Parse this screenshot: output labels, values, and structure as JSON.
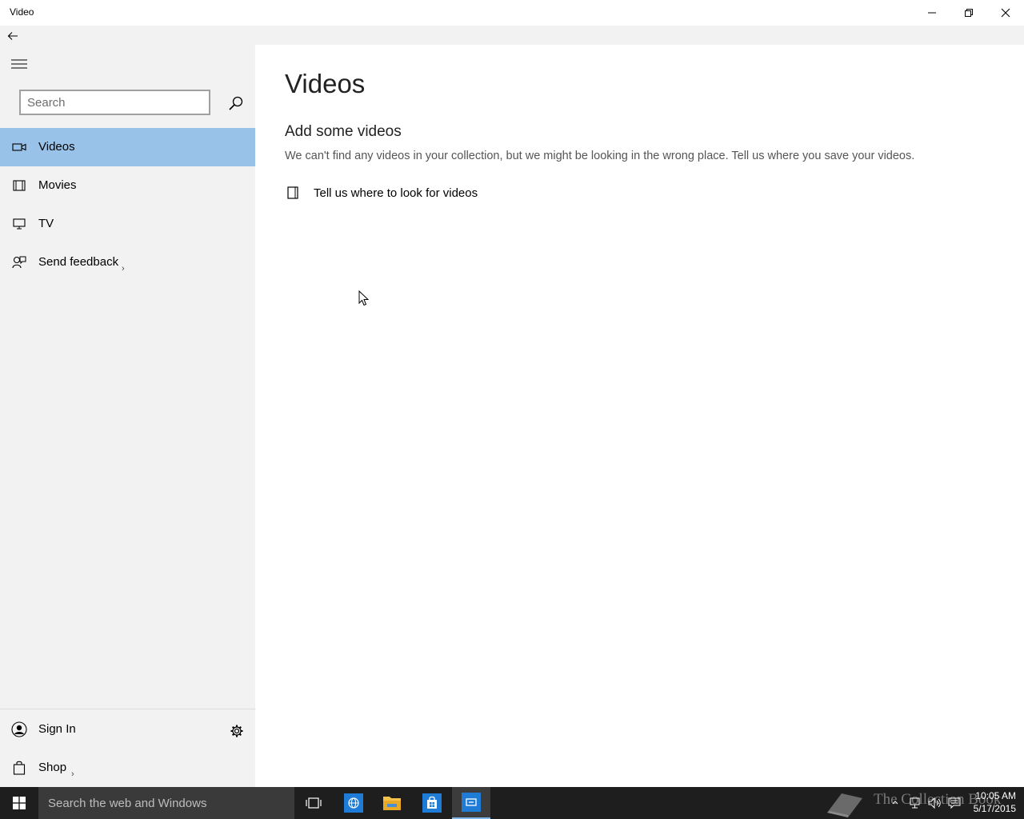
{
  "window": {
    "title": "Video"
  },
  "search": {
    "placeholder": "Search"
  },
  "nav": {
    "items": [
      {
        "label": "Videos",
        "icon": "video-camera-icon",
        "selected": true
      },
      {
        "label": "Movies",
        "icon": "film-icon",
        "selected": false
      },
      {
        "label": "TV",
        "icon": "tv-icon",
        "selected": false
      },
      {
        "label": "Send feedback",
        "icon": "feedback-icon",
        "selected": false
      }
    ],
    "bottom": [
      {
        "label": "Sign In",
        "icon": "user-icon"
      },
      {
        "label": "Shop",
        "icon": "shopping-bag-icon"
      }
    ]
  },
  "main": {
    "title": "Videos",
    "section_title": "Add some videos",
    "description": "We can't find any videos in your collection, but we might be looking in the wrong place. Tell us where you save your videos.",
    "link_label": "Tell us where to look for videos"
  },
  "taskbar": {
    "search_placeholder": "Search the web and Windows",
    "watermark": "The Collection Book",
    "time": "10:05 AM",
    "date": "5/17/2015"
  },
  "colors": {
    "selected_item": "#99c2e8",
    "sidebar_bg": "#f2f2f2",
    "taskbar_bg": "#1e1e1e",
    "accent": "#0078d7"
  }
}
